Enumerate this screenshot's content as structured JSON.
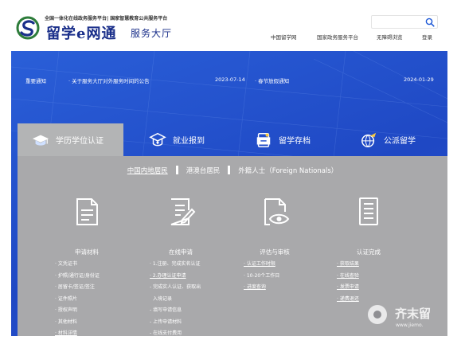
{
  "header": {
    "tagline": "全国一体化在线政务服务平台| 国家智慧教育公共服务平台",
    "brand": "留学e网通",
    "brand_sub": "服务大厅",
    "search": {
      "placeholder": ""
    },
    "nav": [
      "中国留学网",
      "国家政务服务平台",
      "无障碍浏览",
      "登录"
    ]
  },
  "notices": {
    "label": "重要通知",
    "items": [
      {
        "title": "· 关于服务大厅对外服务时间的公告",
        "date": "2023-07-14"
      },
      {
        "title": "· 春节放假通知",
        "date": "2024-01-29"
      }
    ]
  },
  "tabs": [
    {
      "label": "学历学位认证",
      "icon": "graduation-cap-icon",
      "active": true
    },
    {
      "label": "就业报到",
      "icon": "mortarboard-badge-icon",
      "active": false
    },
    {
      "label": "留学存档",
      "icon": "archive-icon",
      "active": false
    },
    {
      "label": "公派留学",
      "icon": "globe-plane-icon",
      "active": false
    }
  ],
  "regions": [
    {
      "label": "中国内地居民",
      "active": true
    },
    {
      "label": "港澳台居民",
      "active": false
    },
    {
      "label": "外籍人士（Foreign Nationals）",
      "active": false
    }
  ],
  "steps": [
    {
      "label": "申请材料",
      "icon": "document-list-icon"
    },
    {
      "label": "在线申请",
      "icon": "edit-document-icon"
    },
    {
      "label": "评估与审核",
      "icon": "view-document-icon"
    },
    {
      "label": "认证完成",
      "icon": "certificate-icon"
    }
  ],
  "materials": [
    "· 文凭证书",
    "· 护照/通行证/身份证",
    "· 居留卡/签证/签注",
    "· 证件照片",
    "· 授权声明",
    "· 其他材料",
    "· 材料详情"
  ],
  "apply_steps": [
    "· 1.注册、完成实名认证",
    "· 2.办理认证申请",
    "- 完成实人认证、获取出",
    "入境记录",
    "- 填写申请信息",
    "- 上传申请材料",
    "- 在线支付费用"
  ],
  "review": [
    "· 认证工作时限",
    "· 10-20个工作日",
    "· 进度查询"
  ],
  "complete": [
    "· 获取结果",
    "· 在线查验",
    "· 发票申请",
    "· 递费退还"
  ],
  "watermark": {
    "text": "齐末留",
    "url": "www.jiemo."
  },
  "colors": {
    "brand": "#1a2f8a",
    "hero": "#2250cc",
    "panel": "#a9a9ab"
  }
}
